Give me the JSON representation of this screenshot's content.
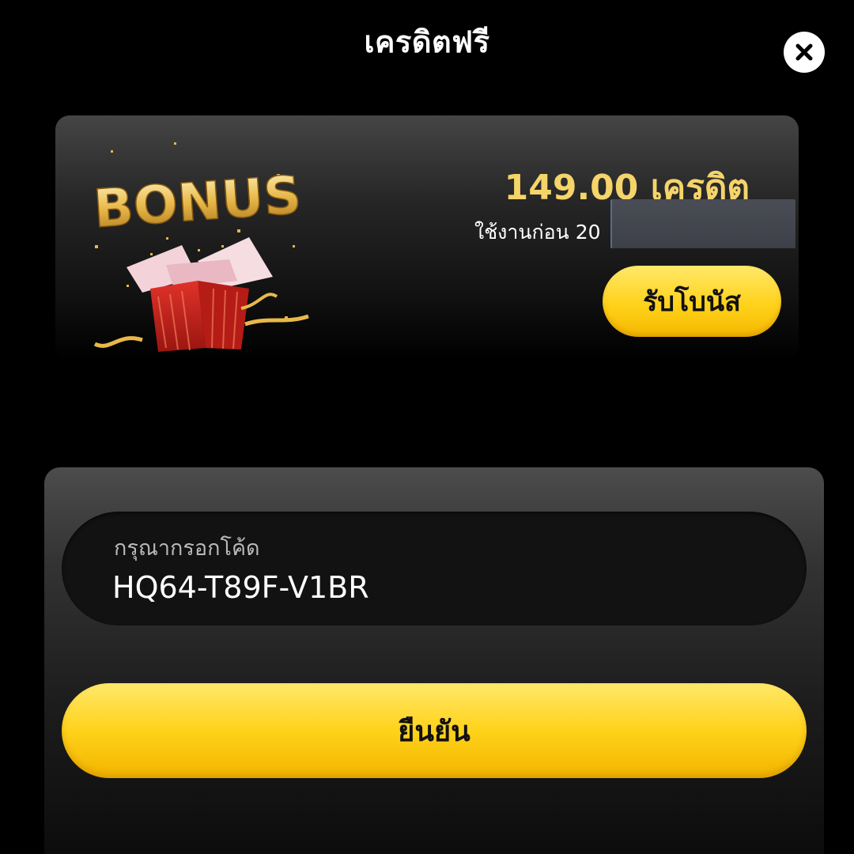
{
  "header": {
    "title": "เครดิตฟรี",
    "close_icon": "close-icon"
  },
  "bonus": {
    "art_text": "BONUS",
    "art_icon": "gift-box-icon",
    "amount": "149.00 เครดิต",
    "expiry_label": "ใช้งานก่อน 20",
    "claim_label": "รับโบนัส"
  },
  "redeem": {
    "field_label": "กรุณากรอกโค้ด",
    "code_value": "HQ64-T89F-V1BR",
    "confirm_label": "ยืนยัน"
  },
  "colors": {
    "accent_yellow": "#ffd21a",
    "amount_gold": "#f5d46a",
    "background": "#000000"
  }
}
